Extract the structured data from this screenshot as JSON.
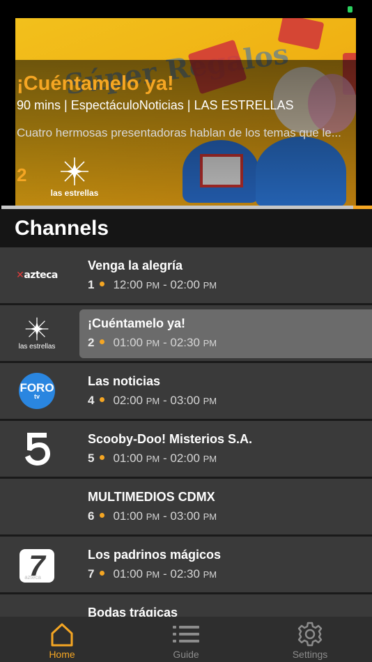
{
  "hero": {
    "title": "¡Cuéntamelo ya!",
    "meta": "90 mins | EspectáculoNoticias | LAS ESTRELLAS",
    "description": "Cuatro hermosas presentadoras hablan de los temas que le...",
    "channel_number": "2",
    "channel_logo_text": "las estrellas",
    "progress": 0.05,
    "colors": {
      "accent": "#f5a623"
    }
  },
  "channels": {
    "heading": "Channels",
    "items": [
      {
        "logo": "azteca-uno-logo",
        "logo_text": "azteca",
        "program": "Venga la alegría",
        "number": "1",
        "start": "12:00",
        "start_ampm": "PM",
        "end": "02:00",
        "end_ampm": "PM",
        "selected": false
      },
      {
        "logo": "las-estrellas-logo",
        "logo_text": "las estrellas",
        "program": "¡Cuéntamelo ya!",
        "number": "2",
        "start": "01:00",
        "start_ampm": "PM",
        "end": "02:30",
        "end_ampm": "PM",
        "selected": true
      },
      {
        "logo": "foro-tv-logo",
        "logo_text": "FORO",
        "logo_subtext": "tv",
        "program": "Las noticias",
        "number": "4",
        "start": "02:00",
        "start_ampm": "PM",
        "end": "03:00",
        "end_ampm": "PM",
        "selected": false
      },
      {
        "logo": "canal-5-logo",
        "logo_text": "5",
        "program": "Scooby-Doo! Misterios S.A.",
        "number": "5",
        "start": "01:00",
        "start_ampm": "PM",
        "end": "02:00",
        "end_ampm": "PM",
        "selected": false
      },
      {
        "logo": "none",
        "program": "MULTIMEDIOS CDMX",
        "number": "6",
        "start": "01:00",
        "start_ampm": "PM",
        "end": "03:00",
        "end_ampm": "PM",
        "selected": false
      },
      {
        "logo": "azteca-7-logo",
        "logo_text": "7",
        "logo_subtext": "azteca",
        "program": "Los padrinos mágicos",
        "number": "7",
        "start": "01:00",
        "start_ampm": "PM",
        "end": "02:30",
        "end_ampm": "PM",
        "selected": false
      },
      {
        "logo": "partial-logo",
        "program": "Bodas trágicas",
        "number": "",
        "start": "",
        "start_ampm": "",
        "end": "",
        "end_ampm": "",
        "selected": false
      }
    ]
  },
  "tabbar": {
    "home": "Home",
    "guide": "Guide",
    "settings": "Settings",
    "active": "home"
  }
}
